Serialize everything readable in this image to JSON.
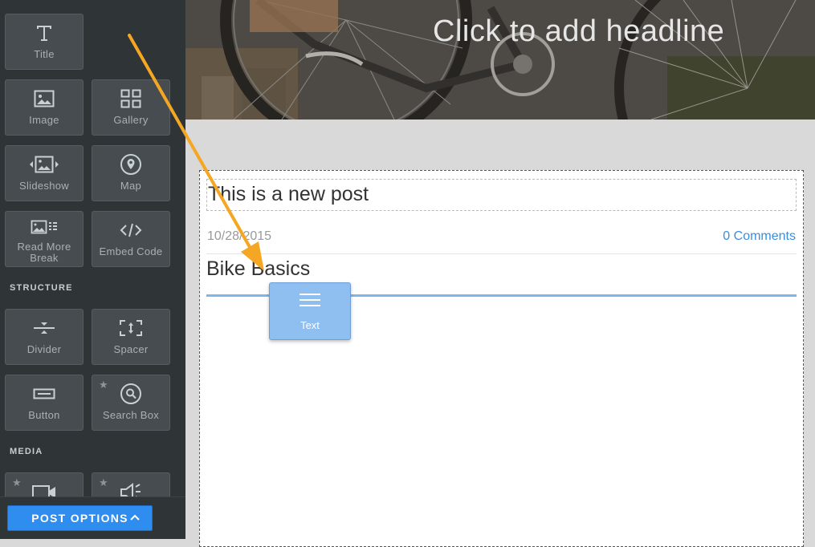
{
  "sidebar": {
    "elements": [
      {
        "label": "Title",
        "icon": "title-t-icon"
      },
      {
        "label": "Image",
        "icon": "image-icon"
      },
      {
        "label": "Gallery",
        "icon": "gallery-grid-icon"
      },
      {
        "label": "Slideshow",
        "icon": "slideshow-icon"
      },
      {
        "label": "Map",
        "icon": "map-pin-icon"
      },
      {
        "label": "Read More Break",
        "icon": "read-more-icon"
      },
      {
        "label": "Embed Code",
        "icon": "code-icon"
      }
    ],
    "structure_heading": "STRUCTURE",
    "structure": [
      {
        "label": "Divider",
        "icon": "divider-icon"
      },
      {
        "label": "Spacer",
        "icon": "spacer-icon"
      },
      {
        "label": "Button",
        "icon": "button-icon"
      },
      {
        "label": "Search Box",
        "icon": "search-icon",
        "premium": true
      }
    ],
    "media_heading": "MEDIA",
    "media": [
      {
        "label": "",
        "icon": "video-icon",
        "premium": true
      },
      {
        "label": "",
        "icon": "audio-icon",
        "premium": true
      }
    ],
    "post_options_label": "POST OPTIONS"
  },
  "hero": {
    "headline": "Click to add headline"
  },
  "post": {
    "title": "This is a new post",
    "date": "10/28/2015",
    "comments": "0 Comments",
    "heading": "Bike Basics"
  },
  "drag_item": {
    "label": "Text",
    "icon": "text-lines-icon"
  },
  "colors": {
    "sidebar_bg": "#2f3437",
    "tile_bg": "#464c50",
    "accent_blue": "#2f8df0",
    "drop_indicator": "#7bb6ec",
    "annotation_arrow": "#f5a623",
    "link_blue": "#3a8edb"
  }
}
